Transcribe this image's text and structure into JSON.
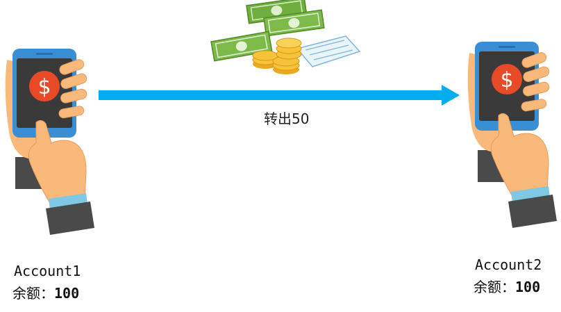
{
  "transfer": {
    "label": "转出50"
  },
  "accounts": [
    {
      "name": "Account1",
      "balance_label": "余额：",
      "balance": "100"
    },
    {
      "name": "Account2",
      "balance_label": "余额：",
      "balance": "100"
    }
  ],
  "colors": {
    "arrow": "#00AEEF",
    "phone_frame": "#3A8FD4",
    "phone_screen": "#3A3A3A",
    "coin_badge": "#E84A27",
    "skin": "#F9B97A",
    "sleeve": "#4A4A4A",
    "cuff": "#7EC8E3",
    "cash": "#7DBA4A",
    "coins": "#F7C33A"
  },
  "icons": [
    "phone-in-hand-icon",
    "dollar-icon",
    "money-stack-icon",
    "coin-stack-icon",
    "receipt-icon",
    "arrow-right-icon"
  ]
}
